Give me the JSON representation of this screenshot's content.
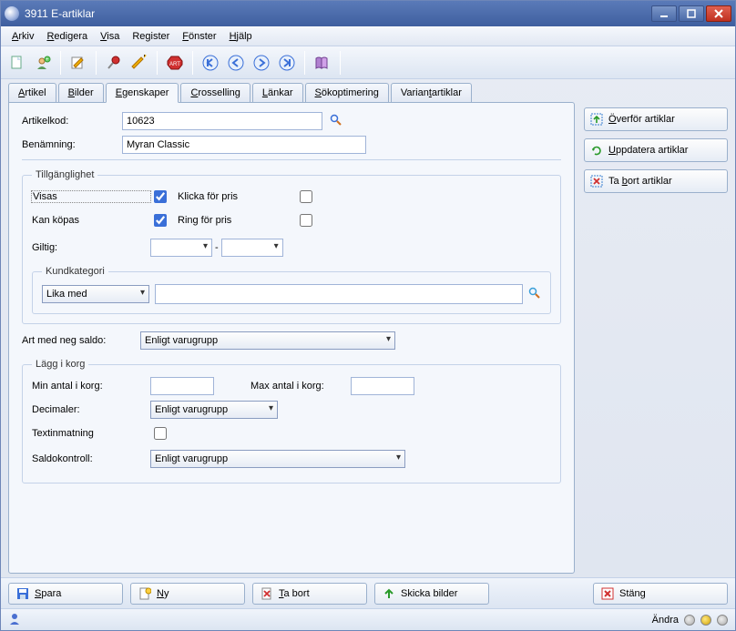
{
  "window": {
    "title": "3911 E-artiklar"
  },
  "menu": {
    "arkiv": "Arkiv",
    "redigera": "Redigera",
    "visa": "Visa",
    "register": "Register",
    "fonster": "Fönster",
    "hjalp": "Hjälp"
  },
  "tabs": {
    "artikel": "Artikel",
    "bilder": "Bilder",
    "egenskaper": "Egenskaper",
    "crosselling": "Crosselling",
    "lankar": "Länkar",
    "sokoptimering": "Sökoptimering",
    "variantartiklar": "Variantartiklar"
  },
  "side": {
    "overfor": "Överför artiklar",
    "uppdatera": "Uppdatera artiklar",
    "tabort": "Ta bort artiklar"
  },
  "form": {
    "artikelkod_label": "Artikelkod:",
    "artikelkod_value": "10623",
    "benamning_label": "Benämning:",
    "benamning_value": "Myran Classic",
    "tillganglighet_legend": "Tillgänglighet",
    "visas_label": "Visas",
    "visas_checked": true,
    "kankopas_label": "Kan köpas",
    "kankopas_checked": true,
    "klicka_label": "Klicka för pris",
    "klicka_checked": false,
    "ring_label": "Ring för pris",
    "ring_checked": false,
    "giltig_label": "Giltig:",
    "giltig_from": "",
    "giltig_sep": "-",
    "giltig_to": "",
    "kundkategori_legend": "Kundkategori",
    "kundkategori_op": "Lika med",
    "kundkategori_value": "",
    "artneg_label": "Art med neg saldo:",
    "artneg_value": "Enligt varugrupp",
    "laggikorg_legend": "Lägg i korg",
    "minantal_label": "Min antal i korg:",
    "minantal_value": "",
    "maxantal_label": "Max antal i korg:",
    "maxantal_value": "",
    "decimaler_label": "Decimaler:",
    "decimaler_value": "Enligt varugrupp",
    "textinmatning_label": "Textinmatning",
    "textinmatning_checked": false,
    "saldokontroll_label": "Saldokontroll:",
    "saldokontroll_value": "Enligt varugrupp"
  },
  "bottom": {
    "spara": "Spara",
    "ny": "Ny",
    "tabort": "Ta bort",
    "skicka": "Skicka bilder",
    "stang": "Stäng"
  },
  "status": {
    "andra": "Ändra"
  }
}
